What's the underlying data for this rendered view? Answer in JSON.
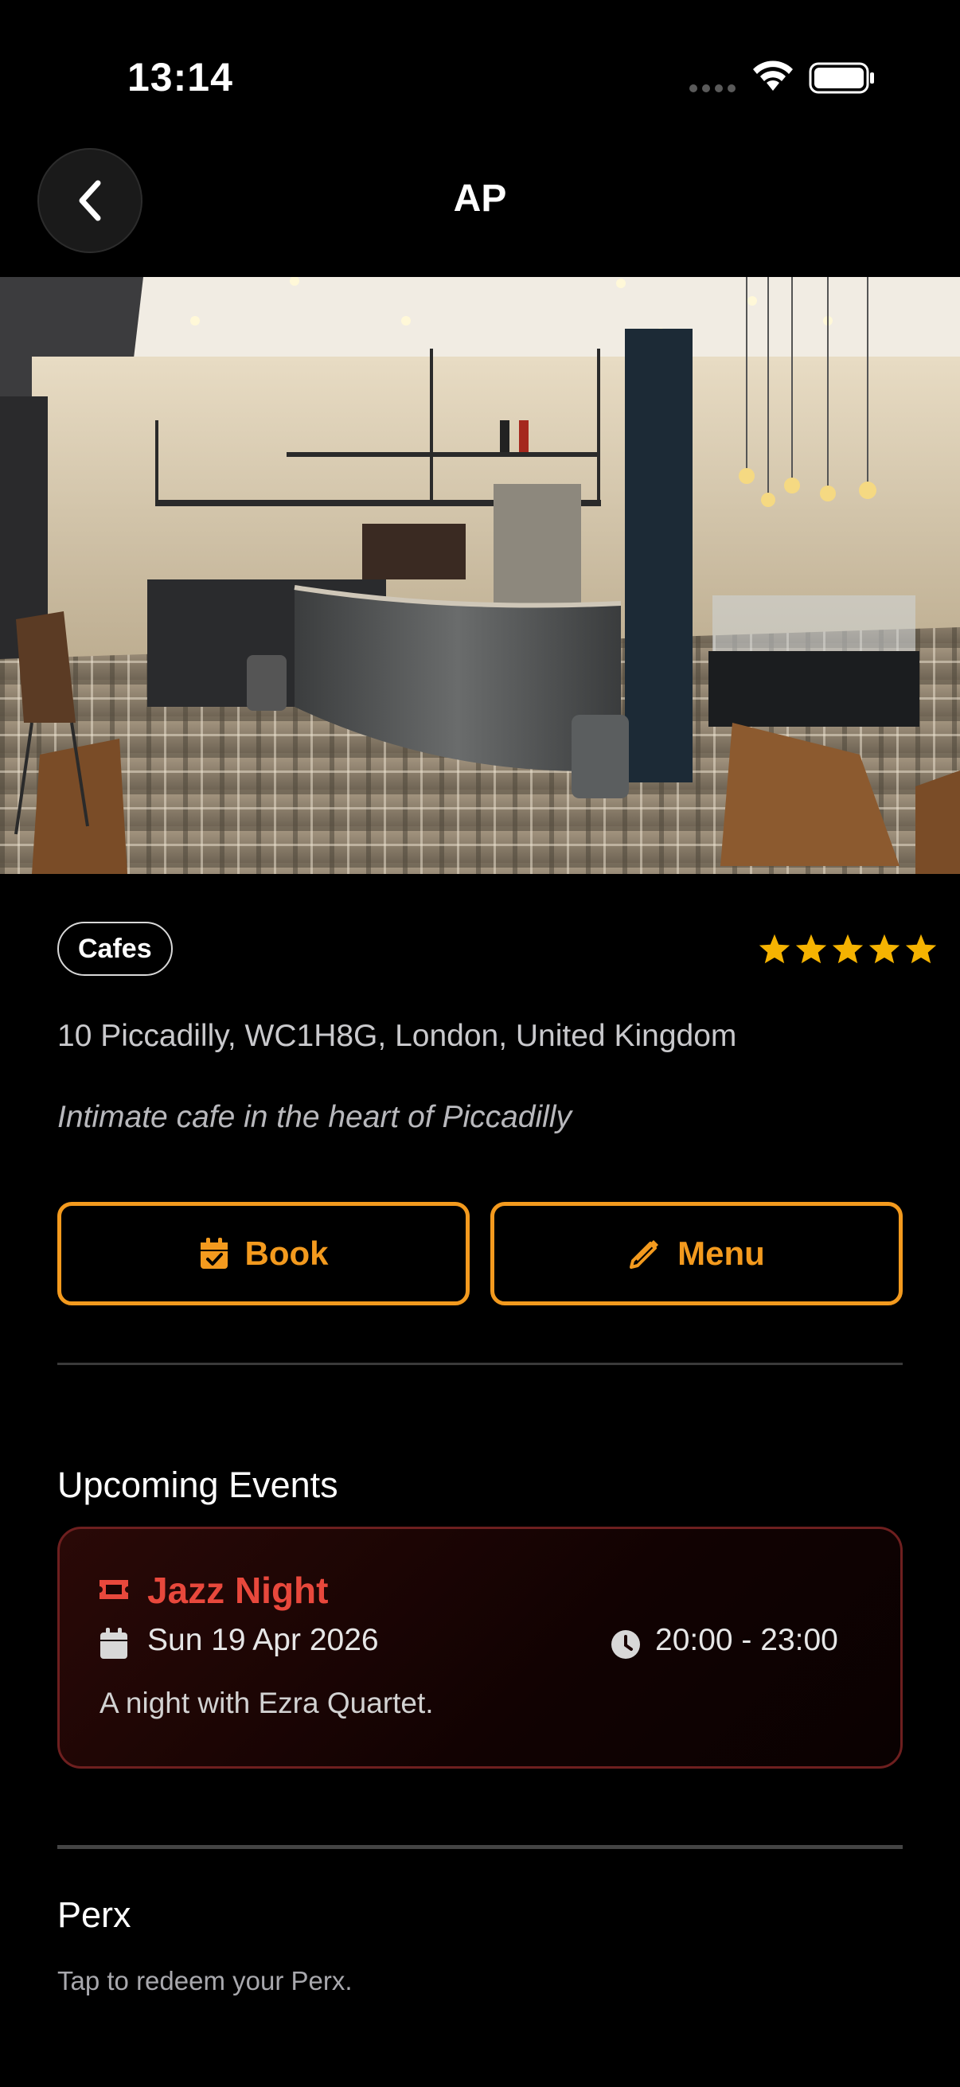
{
  "status": {
    "time": "13:14"
  },
  "header": {
    "title": "AP"
  },
  "venue": {
    "category": "Cafes",
    "rating": 5,
    "address": "10 Piccadilly, WC1H8G, London, United Kingdom",
    "description": "Intimate cafe in the heart of Piccadilly"
  },
  "actions": {
    "book_label": "Book",
    "menu_label": "Menu"
  },
  "events": {
    "heading": "Upcoming Events",
    "items": [
      {
        "title": "Jazz Night",
        "date": "Sun 19 Apr 2026",
        "time": "20:00 - 23:00",
        "description": "A night with Ezra Quartet."
      }
    ]
  },
  "perx": {
    "heading": "Perx",
    "subtitle": "Tap to redeem your Perx."
  },
  "colors": {
    "accent": "#f39a1e",
    "event_title": "#e8483c",
    "star": "#f5b301"
  }
}
